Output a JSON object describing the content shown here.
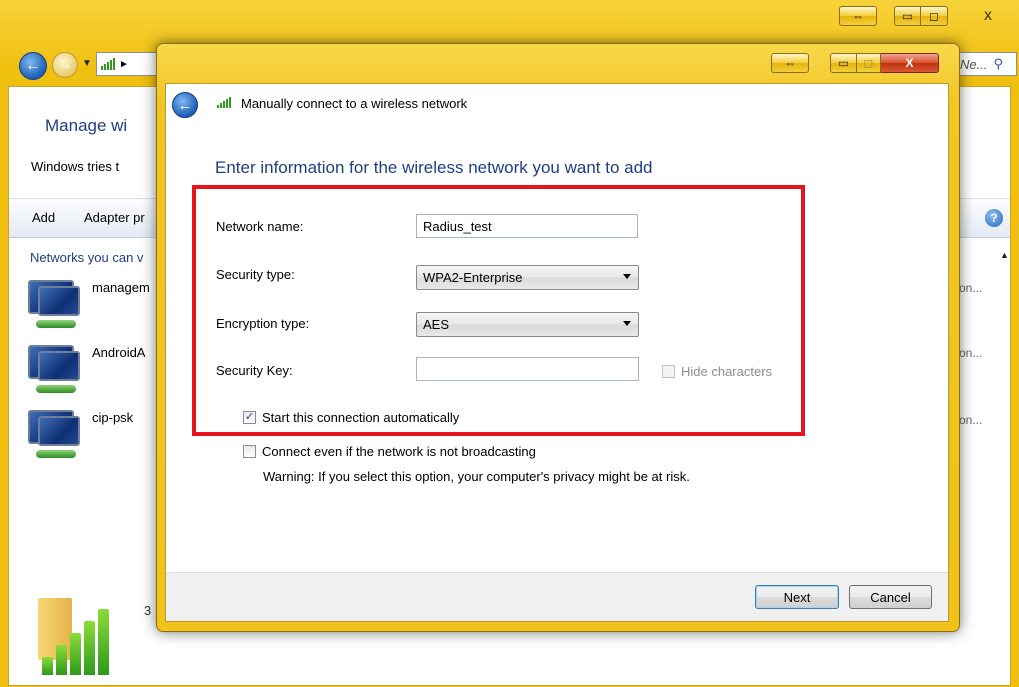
{
  "background_window": {
    "heading": "Manage wi",
    "description": "Windows tries t",
    "toolbar": {
      "add_label": "Add",
      "adapter_label": "Adapter pr"
    },
    "search_placeholder": "Ne...",
    "networks_label": "Networks you can v",
    "networks": [
      {
        "name": "managem",
        "status": "on..."
      },
      {
        "name": "AndroidA",
        "status": "on..."
      },
      {
        "name": "cip-psk",
        "status": "on..."
      }
    ],
    "footer_count": "3",
    "resize_glyph": "⇔",
    "minimize_glyph": "▭",
    "maximize_glyph": "◻",
    "close_glyph": "X",
    "help_glyph": "?"
  },
  "dialog": {
    "title": "Manually connect to a wireless network",
    "heading": "Enter information for the wireless network you want to add",
    "form": {
      "network_name_label": "Network name:",
      "network_name_value": "Radius_test",
      "security_type_label": "Security type:",
      "security_type_value": "WPA2-Enterprise",
      "encryption_type_label": "Encryption type:",
      "encryption_type_value": "AES",
      "security_key_label": "Security Key:",
      "security_key_value": "",
      "hide_characters_label": "Hide characters",
      "hide_characters_checked": false,
      "start_auto_label": "Start this connection automatically",
      "start_auto_checked": true,
      "connect_hidden_label": "Connect even if the network is not broadcasting",
      "connect_hidden_checked": false,
      "warning_text": "Warning: If you select this option, your computer's privacy might be at risk."
    },
    "buttons": {
      "next_label": "Next",
      "cancel_label": "Cancel"
    },
    "highlight_color": "#e3161f",
    "resize_glyph": "⇔",
    "minimize_glyph": "▭",
    "close_glyph": "X"
  }
}
